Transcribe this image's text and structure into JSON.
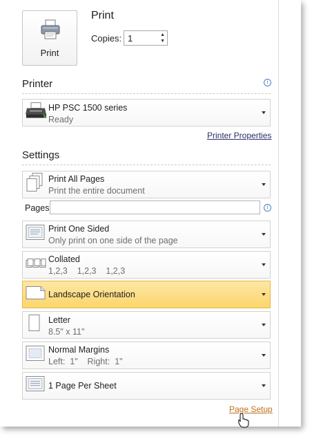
{
  "print": {
    "heading": "Print",
    "button_label": "Print",
    "copies_label": "Copies:",
    "copies_value": "1"
  },
  "printer": {
    "heading": "Printer",
    "name": "HP PSC 1500 series",
    "status": "Ready",
    "properties_link": "Printer Properties"
  },
  "settings": {
    "heading": "Settings",
    "pages_label": "Pages:",
    "pages_value": "",
    "items": [
      {
        "title": "Print All Pages",
        "subtitle": "Print the entire document",
        "icon": "pages-icon"
      },
      {
        "title": "Print One Sided",
        "subtitle": "Only print on one side of the page",
        "icon": "one-sided-icon"
      },
      {
        "title": "Collated",
        "subtitle": "1,2,3    1,2,3    1,2,3",
        "icon": "collated-icon"
      },
      {
        "title": "Landscape Orientation",
        "subtitle": "",
        "icon": "landscape-icon"
      },
      {
        "title": "Letter",
        "subtitle": "8.5\" x 11\"",
        "icon": "letter-icon"
      },
      {
        "title": "Normal Margins",
        "subtitle": "Left:  1\"    Right:  1\"",
        "icon": "margins-icon"
      },
      {
        "title": "1 Page Per Sheet",
        "subtitle": "",
        "icon": "page-per-sheet-icon"
      }
    ],
    "page_setup_link": "Page Setup"
  },
  "colors": {
    "highlight": "#fbd66c",
    "link_orange": "#c0701c",
    "link_blue": "#2a2a6a"
  }
}
